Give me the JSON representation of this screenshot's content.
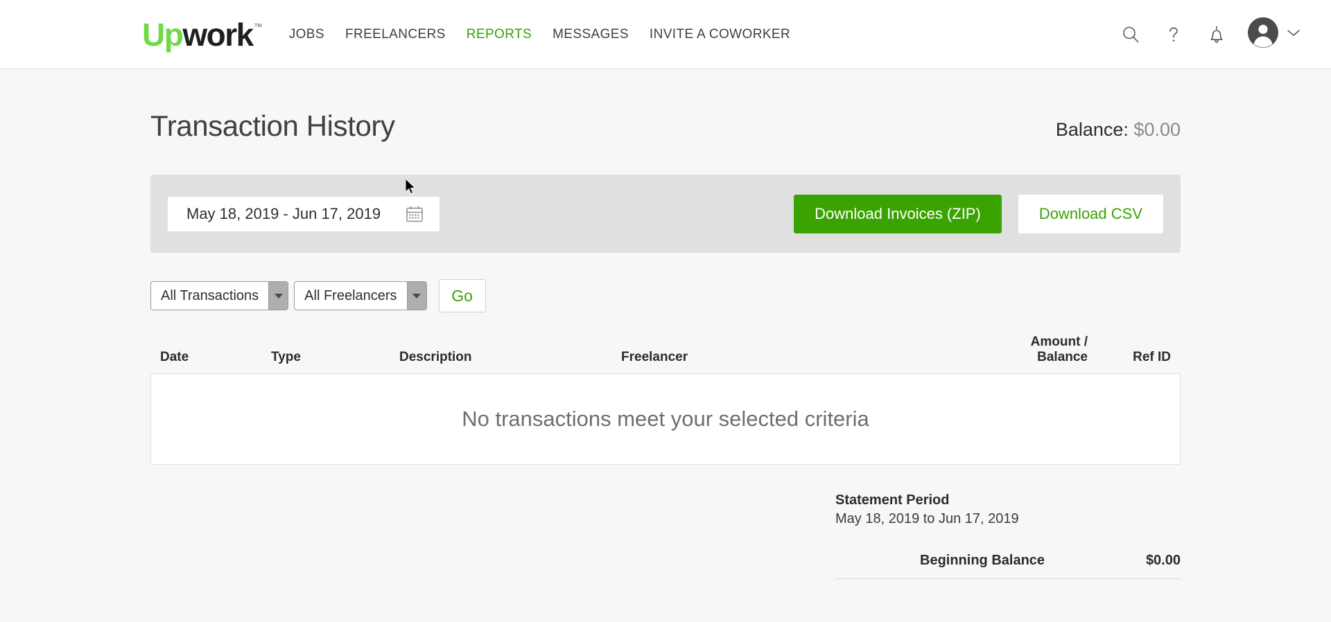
{
  "header": {
    "brand": {
      "part1": "Up",
      "part2": "work",
      "tm": "™"
    },
    "nav": [
      {
        "label": "JOBS",
        "active": false
      },
      {
        "label": "FREELANCERS",
        "active": false
      },
      {
        "label": "REPORTS",
        "active": true
      },
      {
        "label": "MESSAGES",
        "active": false
      },
      {
        "label": "INVITE A COWORKER",
        "active": false
      }
    ],
    "tools": [
      {
        "icon": "search-icon"
      },
      {
        "icon": "help-icon"
      },
      {
        "icon": "notifications-bell-icon"
      },
      {
        "icon": "avatar"
      },
      {
        "icon": "chevron-down-icon"
      }
    ]
  },
  "page": {
    "title": "Transaction History",
    "balance_label": "Balance:",
    "balance_amount": "$0.00"
  },
  "filter_bar": {
    "date_range": "May 18, 2019 - Jun 17, 2019",
    "calendar_icon": "calendar-icon",
    "download_zip_label": "Download Invoices (ZIP)",
    "download_csv_label": "Download CSV"
  },
  "filters": {
    "transaction_type": "All Transactions",
    "freelancer": "All Freelancers",
    "go_label": "Go"
  },
  "table": {
    "columns": {
      "date": "Date",
      "type": "Type",
      "description": "Description",
      "freelancer": "Freelancer",
      "amount_line1": "Amount /",
      "amount_line2": "Balance",
      "ref_id": "Ref ID"
    },
    "empty_message": "No transactions meet your selected criteria"
  },
  "summary": {
    "statement_period_title": "Statement Period",
    "statement_period_value": "May 18, 2019 to Jun 17, 2019",
    "beginning_balance_label": "Beginning Balance",
    "beginning_balance_value": "$0.00"
  },
  "colors": {
    "brand_green": "#6fda44",
    "action_green": "#3aa302",
    "active_nav": "#37a000",
    "page_bg": "#f7f7f7",
    "filter_bar_bg": "#e0e0e0"
  }
}
